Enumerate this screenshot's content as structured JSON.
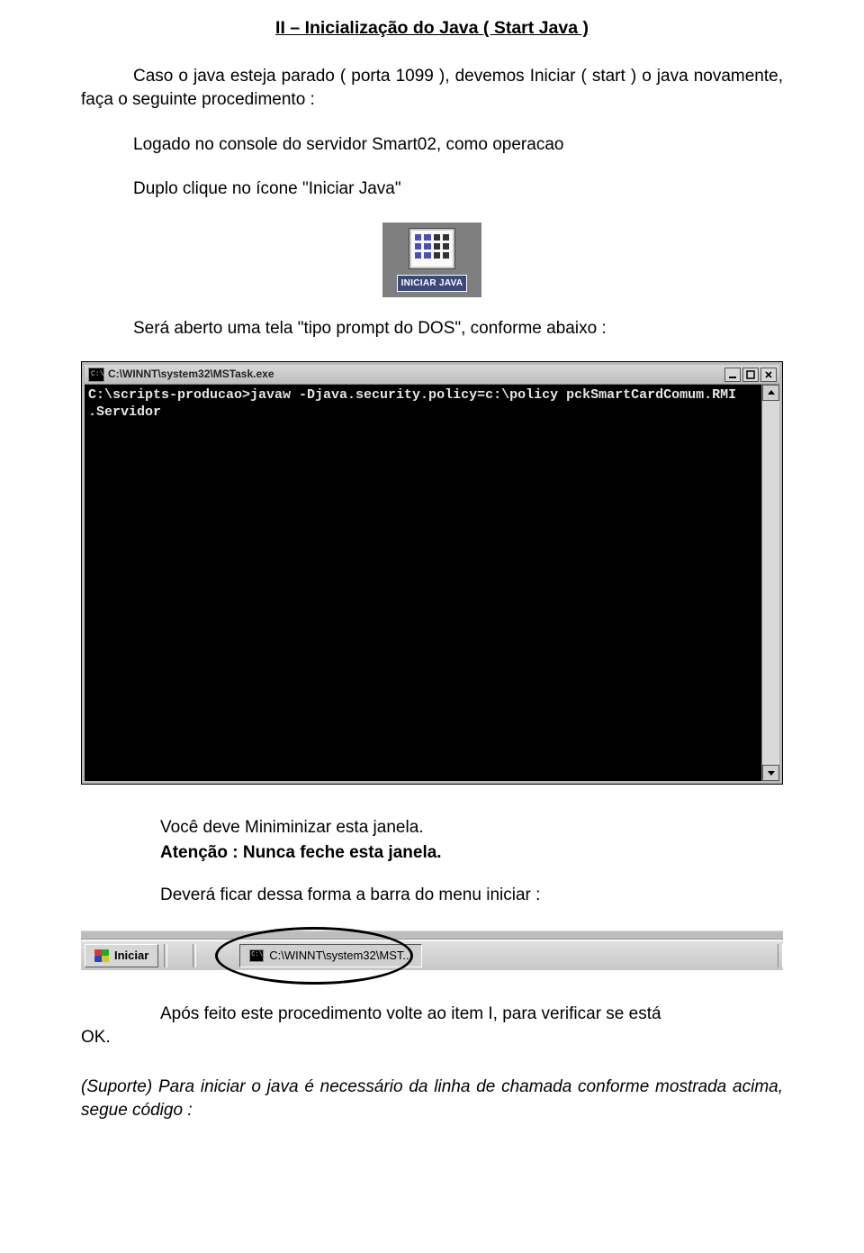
{
  "title": "II – Inicialização do Java ( Start Java )",
  "p1": "Caso o java esteja parado ( porta 1099 ), devemos Iniciar ( start ) o java novamente, faça o seguinte procedimento :",
  "p2": "Logado no console do servidor Smart02, como operacao",
  "p3": "Duplo clique no ícone \"Iniciar Java\"",
  "deskIcon": {
    "label": "INICIAR JAVA"
  },
  "p4": "Será aberto uma tela \"tipo prompt do DOS\", conforme abaixo :",
  "console": {
    "title": "C:\\WINNT\\system32\\MSTask.exe",
    "cmd": "C:\\scripts-producao>javaw -Djava.security.policy=c:\\policy pckSmartCardComum.RMI\n.Servidor"
  },
  "p5": "Você deve Miniminizar esta janela.",
  "p6_label": "Atenção :",
  "p6_rest": "  Nunca feche esta janela.",
  "p7": "Deverá ficar dessa forma a barra do menu iniciar :",
  "taskbar": {
    "start": "Iniciar",
    "taskItem": "C:\\WINNT\\system32\\MST..."
  },
  "p8_line1": "Após feito este procedimento volte ao item I, para verificar se está",
  "p8_line2": "OK.",
  "p9": "(Suporte) Para iniciar o java é necessário da linha de chamada conforme mostrada acima, segue código :"
}
